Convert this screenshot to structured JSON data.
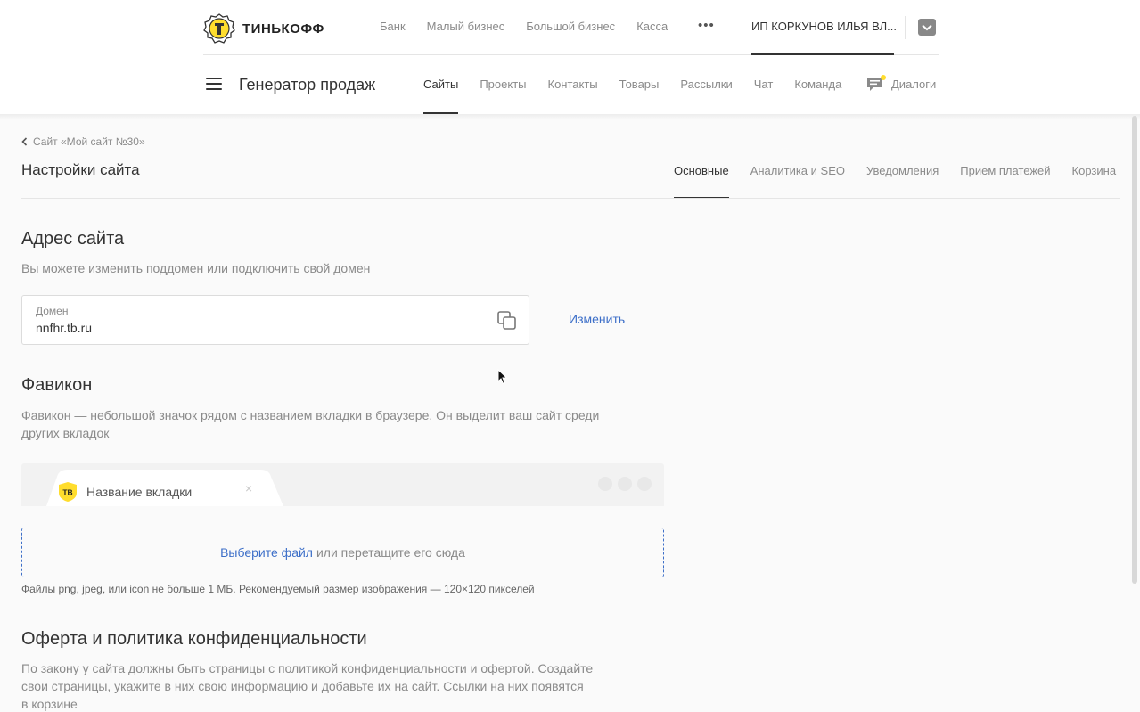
{
  "colors": {
    "accent_link": "#3d6fc8",
    "brand_yellow": "#ffdd2d",
    "text_primary": "#333333",
    "text_muted": "#8a8a8a"
  },
  "header": {
    "logo_text": "ТИНЬКОФФ",
    "top_links": [
      "Банк",
      "Малый бизнес",
      "Большой бизнес",
      "Касса"
    ],
    "more_icon": "more-dots-icon",
    "account_name": "ИП КОРКУНОВ ИЛЬЯ ВЛ...",
    "product_name": "Генератор продаж",
    "nav_tabs": [
      {
        "label": "Сайты",
        "active": true
      },
      {
        "label": "Проекты",
        "active": false
      },
      {
        "label": "Контакты",
        "active": false
      },
      {
        "label": "Товары",
        "active": false
      },
      {
        "label": "Рассылки",
        "active": false
      },
      {
        "label": "Чат",
        "active": false
      },
      {
        "label": "Команда",
        "active": false
      }
    ],
    "dialogs_label": "Диалоги"
  },
  "page": {
    "breadcrumb": "Сайт «Мой сайт №30»",
    "title": "Настройки сайта",
    "settings_tabs": [
      {
        "label": "Основные",
        "active": true
      },
      {
        "label": "Аналитика и SEO",
        "active": false
      },
      {
        "label": "Уведомления",
        "active": false
      },
      {
        "label": "Прием платежей",
        "active": false
      },
      {
        "label": "Корзина",
        "active": false
      }
    ]
  },
  "address": {
    "title": "Адрес сайта",
    "description": "Вы можете изменить поддомен или подключить свой домен",
    "field_label": "Домен",
    "field_value": "nnfhr.tb.ru",
    "change_label": "Изменить"
  },
  "favicon": {
    "title": "Фавикон",
    "description_line1": "Фавикон — небольшой значок рядом с названием вкладки в браузере. Он выделит ваш сайт среди",
    "description_line2": "других вкладок",
    "preview_badge": "ТВ",
    "preview_tab_label": "Название вкладки",
    "preview_close": "×",
    "drop_link": "Выберите файл",
    "drop_rest": "или перетащите его сюда",
    "file_hint": "Файлы png, jpeg, или icon не больше 1 МБ. Рекомендуемый размер изображения — 120×120 пикселей"
  },
  "offer": {
    "title": "Оферта и политика конфиденциальности",
    "description_line1": "По закону у сайта должны быть страницы с политикой конфиденциальности и офертой. Создайте",
    "description_line2": "свои страницы, укажите в них свою информацию и добавьте их на сайт. Ссылки на них появятся",
    "description_line3": "в корзине"
  }
}
